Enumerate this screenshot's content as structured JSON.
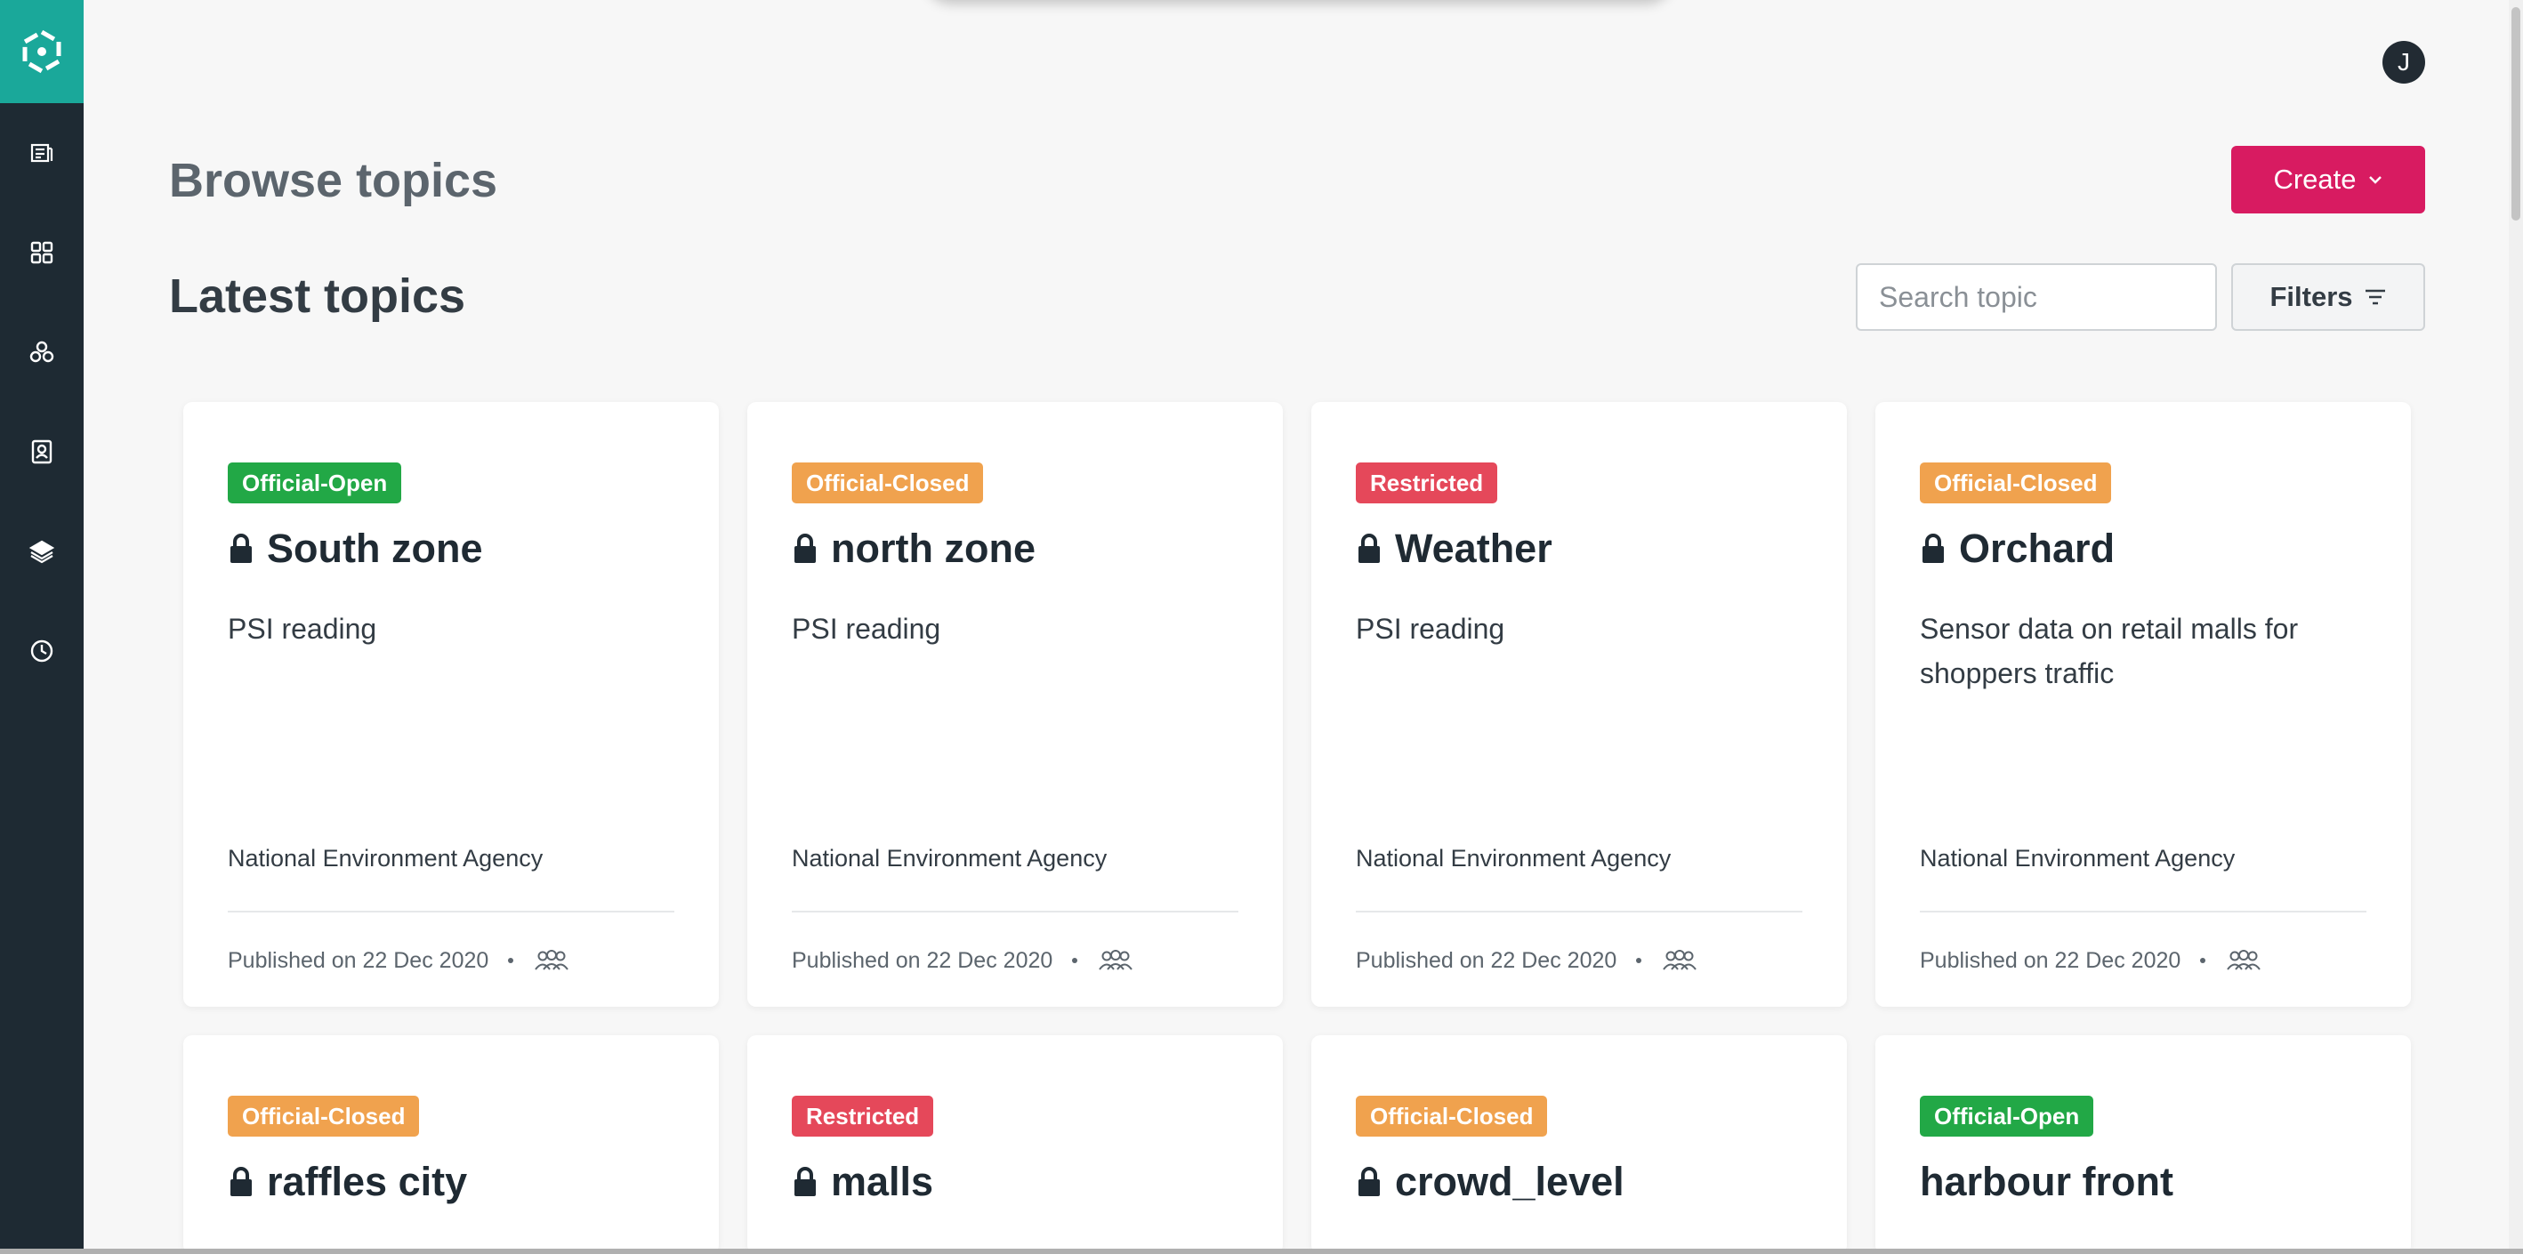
{
  "header": {
    "avatar_initial": "J",
    "page_title": "Browse topics",
    "create_label": "Create"
  },
  "sidebar": {
    "items": [
      {
        "icon": "topics-icon"
      },
      {
        "icon": "dashboard-grid-icon"
      },
      {
        "icon": "network-icon"
      },
      {
        "icon": "contacts-icon"
      },
      {
        "icon": "layers-icon"
      },
      {
        "icon": "clock-icon"
      }
    ]
  },
  "main": {
    "section_title": "Latest topics",
    "search_placeholder": "Search topic",
    "filters_label": "Filters",
    "cards": [
      {
        "badge": "Official-Open",
        "badge_color": "#22a846",
        "locked": true,
        "title": "South zone",
        "desc": "PSI reading",
        "agency": "National Environment Agency",
        "published": "Published on 22 Dec 2020"
      },
      {
        "badge": "Official-Closed",
        "badge_color": "#f0a24e",
        "locked": true,
        "title": "north zone",
        "desc": "PSI reading",
        "agency": "National Environment Agency",
        "published": "Published on 22 Dec 2020"
      },
      {
        "badge": "Restricted",
        "badge_color": "#e5485a",
        "locked": true,
        "title": "Weather",
        "desc": "PSI reading",
        "agency": "National Environment Agency",
        "published": "Published on 22 Dec 2020"
      },
      {
        "badge": "Official-Closed",
        "badge_color": "#f0a24e",
        "locked": true,
        "title": "Orchard",
        "desc": "Sensor data on retail malls for shoppers traffic",
        "agency": "National Environment Agency",
        "published": "Published on 22 Dec 2020"
      },
      {
        "badge": "Official-Closed",
        "badge_color": "#f0a24e",
        "locked": true,
        "title": "raffles city"
      },
      {
        "badge": "Restricted",
        "badge_color": "#e5485a",
        "locked": true,
        "title": "malls"
      },
      {
        "badge": "Official-Closed",
        "badge_color": "#f0a24e",
        "locked": true,
        "title": "crowd_level"
      },
      {
        "badge": "Official-Open",
        "badge_color": "#22a846",
        "locked": false,
        "title": "harbour front"
      }
    ]
  },
  "colors": {
    "sidebar_bg": "#1e2a33",
    "logo_bg": "#1aa89a",
    "accent": "#d81b61"
  }
}
